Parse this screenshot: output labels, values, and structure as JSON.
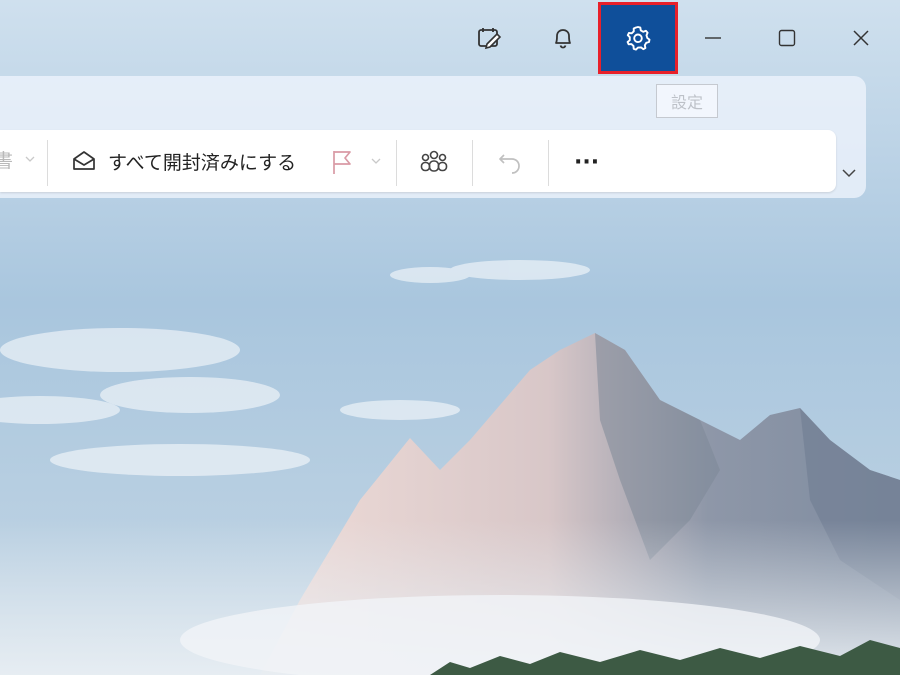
{
  "window": {
    "controls": {
      "minimize_icon": "minimize-icon",
      "maximize_icon": "maximize-icon",
      "close_icon": "close-icon"
    },
    "titlebar_icons": [
      "edit-icon",
      "bell-icon",
      "gear-icon"
    ],
    "settings_tooltip": "設定"
  },
  "ribbon": {
    "truncated_left_text": "書",
    "mark_all_read_label": "すべて開封済みにする",
    "more_label": "···",
    "colors": {
      "flag": "#d99aa5",
      "settings_bg": "#0f4f9a",
      "highlight_border": "#e8202a"
    }
  }
}
